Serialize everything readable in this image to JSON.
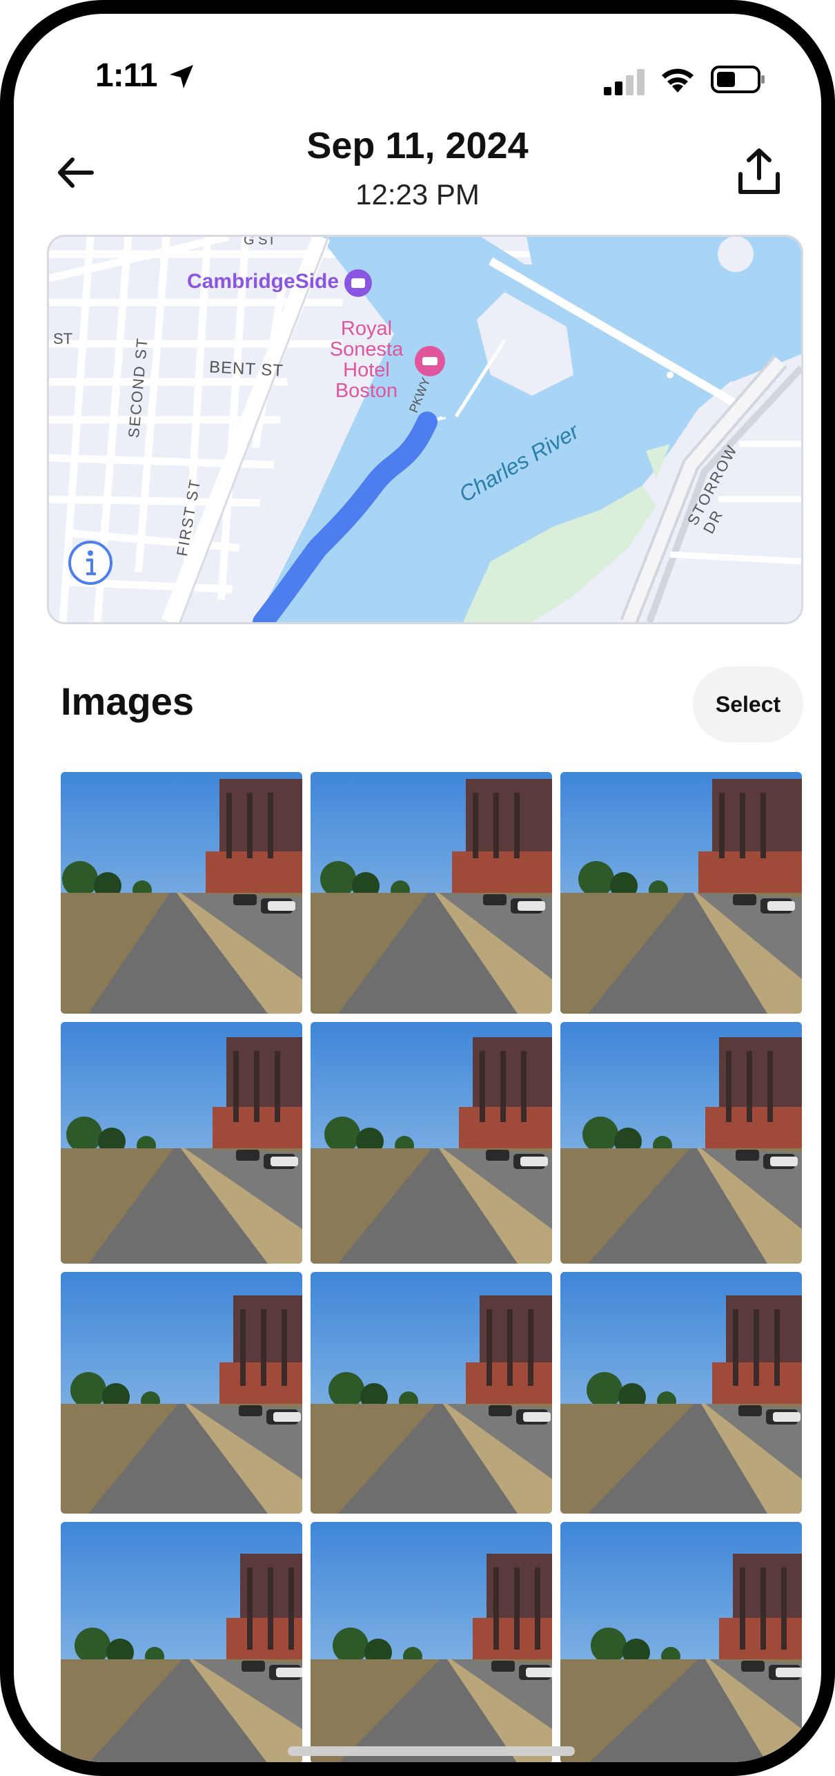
{
  "status_bar": {
    "time": "1:11",
    "signal_icon": "cellular-signal-icon",
    "wifi_icon": "wifi-icon",
    "battery_icon": "battery-icon"
  },
  "header": {
    "date": "Sep 11, 2024",
    "time": "12:23 PM",
    "back_icon": "back-arrow-icon",
    "share_icon": "share-upload-icon"
  },
  "map": {
    "labels": {
      "cambridgeside": "CambridgeSide",
      "hotel": [
        "Royal",
        "Sonesta",
        "Hotel",
        "Boston"
      ],
      "bent_st": "BENT ST",
      "second_st": "SECOND ST",
      "first_st": "FIRST ST",
      "charles_river": "Charles River",
      "storrow_dr": "STORROW DR",
      "st_left": "ST",
      "st_top": "G ST",
      "pkwy": "PKWY"
    },
    "colors": {
      "water": "#a8d4f5",
      "route": "#4d7ef0",
      "land": "#eceef8",
      "park": "#d9efd9",
      "poi_purple": "#8a55e0",
      "poi_pink": "#e0559b"
    },
    "info_icon": "info-icon"
  },
  "images_section": {
    "title": "Images",
    "select_label": "Select",
    "thumbnail_count": 12
  }
}
